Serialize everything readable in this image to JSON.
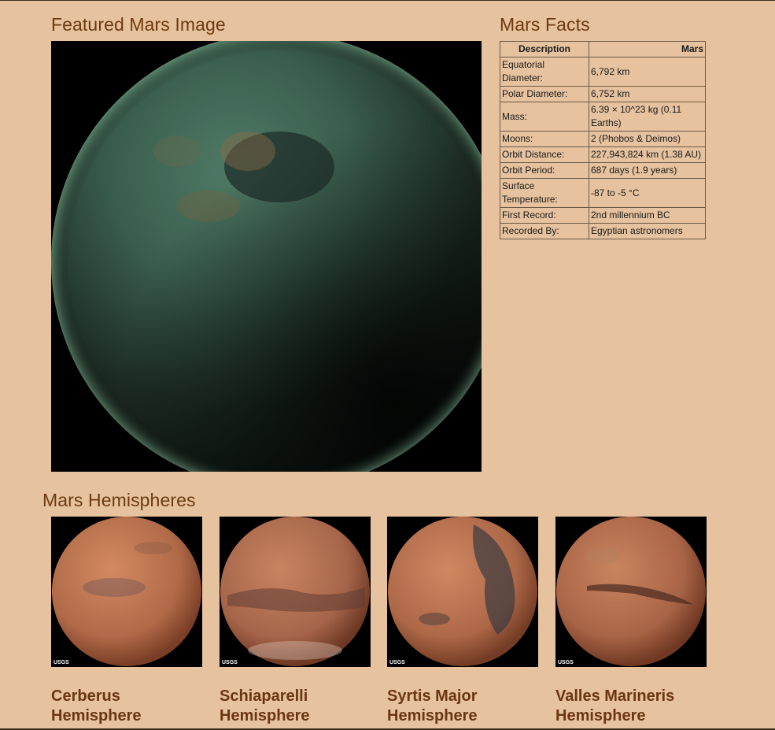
{
  "featured": {
    "title": "Featured Mars Image"
  },
  "facts": {
    "title": "Mars Facts",
    "headers": [
      "Description",
      "Mars"
    ],
    "rows": [
      [
        "Equatorial Diameter:",
        "6,792 km"
      ],
      [
        "Polar Diameter:",
        "6,752 km"
      ],
      [
        "Mass:",
        "6.39 × 10^23 kg (0.11 Earths)"
      ],
      [
        "Moons:",
        "2 (Phobos & Deimos)"
      ],
      [
        "Orbit Distance:",
        "227,943,824 km (1.38 AU)"
      ],
      [
        "Orbit Period:",
        "687 days (1.9 years)"
      ],
      [
        "Surface Temperature:",
        "-87 to -5 °C"
      ],
      [
        "First Record:",
        "2nd millennium BC"
      ],
      [
        "Recorded By:",
        "Egyptian astronomers"
      ]
    ]
  },
  "hemispheres": {
    "title": "Mars Hemispheres",
    "items": [
      {
        "name": "Cerberus Hemisphere",
        "logo": "USGS"
      },
      {
        "name": "Schiaparelli Hemisphere",
        "logo": "USGS"
      },
      {
        "name": "Syrtis Major Hemisphere",
        "logo": "USGS"
      },
      {
        "name": "Valles Marineris Hemisphere",
        "logo": "USGS"
      }
    ]
  },
  "colors": {
    "background": "#e6c29e",
    "heading": "#6e3a10",
    "planet": "#b8704a",
    "titan": "#3d6a58"
  }
}
